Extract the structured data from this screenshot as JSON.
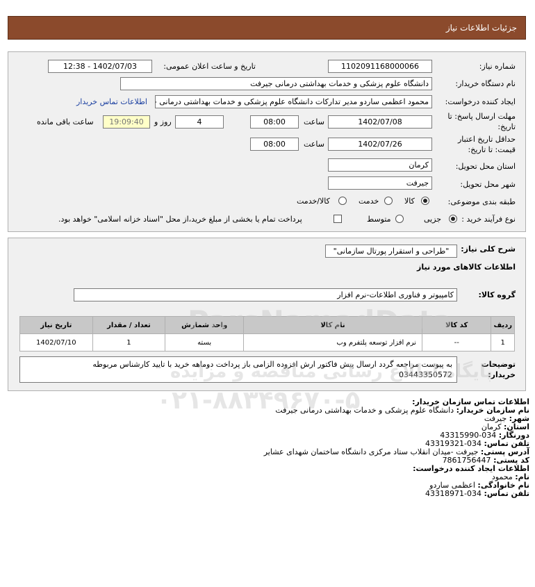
{
  "header": {
    "title": "جزئیات اطلاعات نیاز"
  },
  "form": {
    "need_number_label": "شماره نیاز:",
    "need_number": "1102091168000066",
    "announce_label": "تاریخ و ساعت اعلان عمومی:",
    "announce_value": "1402/07/03 - 12:38",
    "buyer_org_label": "نام دستگاه خریدار:",
    "buyer_org": "دانشگاه علوم پزشکی و خدمات بهداشتی درمانی جیرفت",
    "creator_label": "ایجاد کننده درخواست:",
    "creator": "محمود اعظمی ساردو مدیر تدارکات دانشگاه علوم پزشکی و خدمات بهداشتی درمانی جیرفت",
    "contact_link": "اطلاعات تماس خریدار",
    "deadline_label_1": "مهلت ارسال پاسخ: تا",
    "deadline_label_2": "تاریخ:",
    "deadline_date": "1402/07/08",
    "time_label": "ساعت",
    "deadline_time": "08:00",
    "days": "4",
    "days_label": "روز و",
    "remaining_time": "19:09:40",
    "remaining_label": "ساعت باقی مانده",
    "validity_label_1": "حداقل تاریخ اعتبار",
    "validity_label_2": "قیمت: تا تاریخ:",
    "validity_date": "1402/07/26",
    "validity_time": "08:00",
    "province_label": "استان محل تحویل:",
    "province": "کرمان",
    "city_label": "شهر محل تحویل:",
    "city": "جیرفت",
    "category_label": "طبقه بندی موضوعی:",
    "category_options": [
      "کالا",
      "خدمت",
      "کالا/خدمت"
    ],
    "category_selected": "کالا",
    "process_label": "نوع فرآیند خرید :",
    "process_options": [
      "جزیی",
      "متوسط"
    ],
    "process_selected": "جزیی",
    "payment_text": "پرداخت تمام یا بخشی از مبلغ خرید،از محل \"اسناد خزانه اسلامی\" خواهد بود."
  },
  "need": {
    "summary_label": "شرح کلی نیاز:",
    "summary": "\"طراحی و استقرار پورتال سازمانی\"",
    "goods_title": "اطلاعات کالاهای مورد نیاز",
    "group_label": "گروه کالا:",
    "group_value": "کامپیوتر و فناوری اطلاعات-نرم افزار",
    "table": {
      "headers": [
        "ردیف",
        "کد کالا",
        "نام کالا",
        "واحد شمارش",
        "تعداد / مقدار",
        "تاریخ نیاز"
      ],
      "rows": [
        [
          "1",
          "--",
          "نرم افزار توسعه پلتفرم وب",
          "بسته",
          "1",
          "1402/07/10"
        ]
      ]
    },
    "notes_label_1": "توضیحات",
    "notes_label_2": "خریدار:",
    "notes_line1": "به پیوست مراجعه گردد ارسال پیش فاکتور ارش افزوده الزامی باز پرداخت دوماهه خرید با تایید کارشناس مربوطه",
    "notes_line2": "03443350572"
  },
  "contact": {
    "title": "اطلاعات تماس سازمان خریدار:",
    "org_label": "نام سازمان خریدار:",
    "org_value": "دانشگاه علوم پزشکی و خدمات بهداشتی درمانی جیرفت",
    "city_label": "شهر:",
    "city_value": "جیرفت",
    "province_label": "استان:",
    "province_value": "کرمان",
    "fax_label": "دورنگار:",
    "fax_value": "034-43315990",
    "phone_label": "تلفن تماس:",
    "phone_value": "034-43319321",
    "address_label": "آدرس پستی:",
    "address_value": "جیرفت -میدان انقلاب ستاد مرکزی دانشگاه ساختمان شهدای عشایر",
    "postal_label": "کد پستی:",
    "postal_value": "7861756447",
    "creator_title": "اطلاعات ایجاد کننده درخواست:",
    "first_name_label": "نام:",
    "first_name_value": "محمود",
    "last_name_label": "نام خانوادگی:",
    "last_name_value": "اعظمی ساردو",
    "creator_phone_label": "تلفن تماس:",
    "creator_phone_value": "034-43318971"
  },
  "watermark": {
    "brand": "ParsNamadData",
    "tagline": "پایگاه اطلاع رسانی مناقصه و مزایده",
    "phone": "۰۲۱-۸۸۳۴۹۶۷۰-۵"
  }
}
